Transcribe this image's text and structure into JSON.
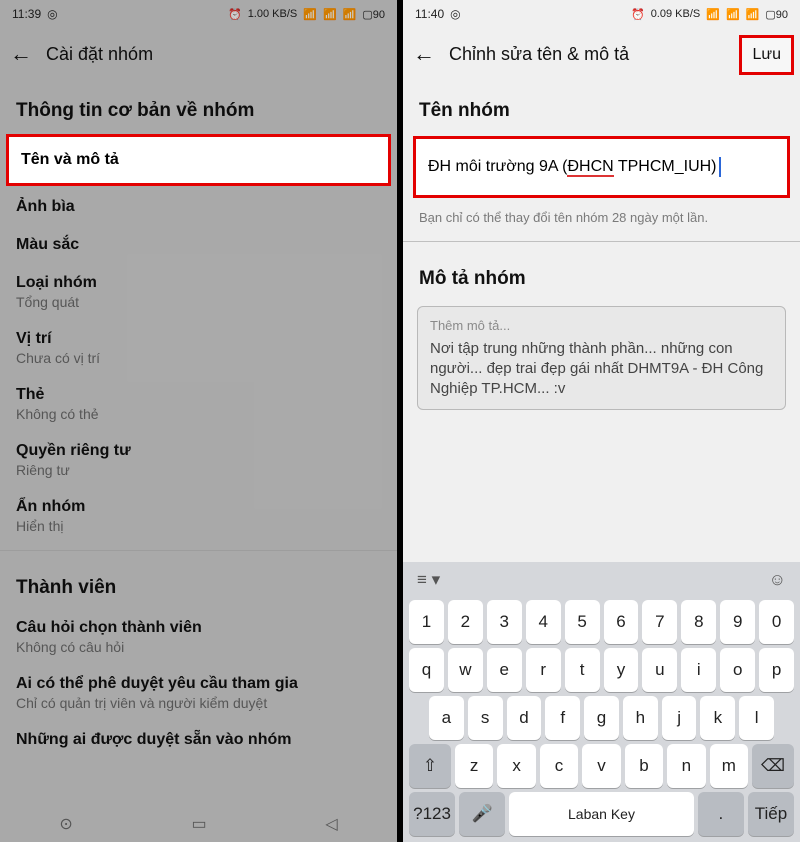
{
  "left": {
    "status": {
      "time": "11:39",
      "net": "1.00 KB/S",
      "battery": "90"
    },
    "appbar_title": "Cài đặt nhóm",
    "section_basic": "Thông tin cơ bản về nhóm",
    "items": {
      "name_desc": "Tên và mô tả",
      "cover": "Ảnh bìa",
      "color": "Màu sắc",
      "type": {
        "label": "Loại nhóm",
        "sub": "Tổng quát"
      },
      "location": {
        "label": "Vị trí",
        "sub": "Chưa có vị trí"
      },
      "tags": {
        "label": "Thẻ",
        "sub": "Không có thẻ"
      },
      "privacy": {
        "label": "Quyền riêng tư",
        "sub": "Riêng tư"
      },
      "hide": {
        "label": "Ẩn nhóm",
        "sub": "Hiển thị"
      }
    },
    "section_members": "Thành viên",
    "members": {
      "questions": {
        "label": "Câu hỏi chọn thành viên",
        "sub": "Không có câu hỏi"
      },
      "approve": {
        "label": "Ai có thể phê duyệt yêu cầu tham gia",
        "sub": "Chỉ có quản trị viên và người kiểm duyệt"
      },
      "preapprove": "Những ai được duyệt sẵn vào nhóm"
    }
  },
  "right": {
    "status": {
      "time": "11:40",
      "net": "0.09 KB/S",
      "battery": "90"
    },
    "appbar_title": "Chỉnh sửa tên & mô tả",
    "save_label": "Lưu",
    "section_name": "Tên nhóm",
    "name_prefix": "ĐH môi trường 9A (",
    "name_underlined": "ĐHCN",
    "name_suffix": " TPHCM_IUH)",
    "helper": "Bạn chỉ có thể thay đổi tên nhóm 28 ngày một lần.",
    "section_desc": "Mô tả nhóm",
    "desc_placeholder": "Thêm mô tả...",
    "desc_text": "Nơi tập trung những thành phần... những con người... đẹp trai đẹp gái nhất DHMT9A - ĐH Công Nghiệp TP.HCM... :v",
    "keyboard": {
      "row1": [
        "1",
        "2",
        "3",
        "4",
        "5",
        "6",
        "7",
        "8",
        "9",
        "0"
      ],
      "row2": [
        "q",
        "w",
        "e",
        "r",
        "t",
        "y",
        "u",
        "i",
        "o",
        "p"
      ],
      "row3": [
        "a",
        "s",
        "d",
        "f",
        "g",
        "h",
        "j",
        "k",
        "l"
      ],
      "row4": [
        "z",
        "x",
        "c",
        "v",
        "b",
        "n",
        "m"
      ],
      "sym": "?123",
      "space": "Laban Key",
      "enter": "Tiếp",
      "period": "."
    }
  }
}
